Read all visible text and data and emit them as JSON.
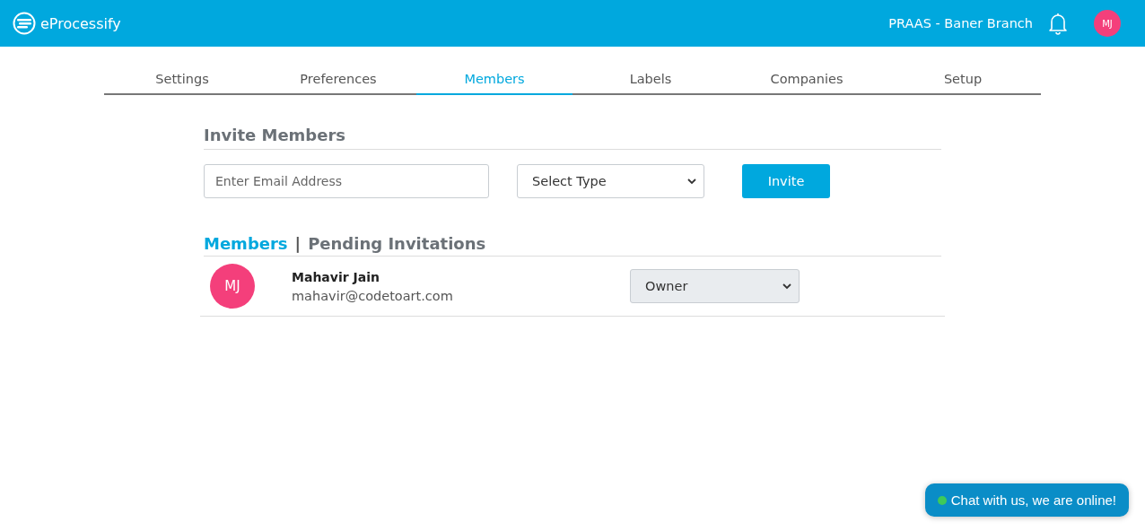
{
  "header": {
    "brand": "eProcessify",
    "branch": "PRAAS - Baner Branch",
    "user_initials": "MJ"
  },
  "tabs": [
    {
      "label": "Settings",
      "selected": false
    },
    {
      "label": "Preferences",
      "selected": false
    },
    {
      "label": "Members",
      "selected": true
    },
    {
      "label": "Labels",
      "selected": false
    },
    {
      "label": "Companies",
      "selected": false
    },
    {
      "label": "Setup",
      "selected": false
    }
  ],
  "invite": {
    "title": "Invite Members",
    "email": {
      "placeholder": "Enter Email Address"
    },
    "type_select": {
      "value": "Select Type"
    },
    "button": "Invite"
  },
  "member_tabs": [
    {
      "label": "Members",
      "selected": true
    },
    {
      "label": "Pending Invitations",
      "selected": false
    }
  ],
  "member_tabs_separator": "|",
  "members": [
    {
      "initials": "MJ",
      "name": "Mahavir Jain",
      "email": "mahavir@codetoart.com",
      "role": "Owner",
      "disabled": true
    }
  ],
  "chat": {
    "label": "Chat with us, we are online!",
    "online": true
  }
}
